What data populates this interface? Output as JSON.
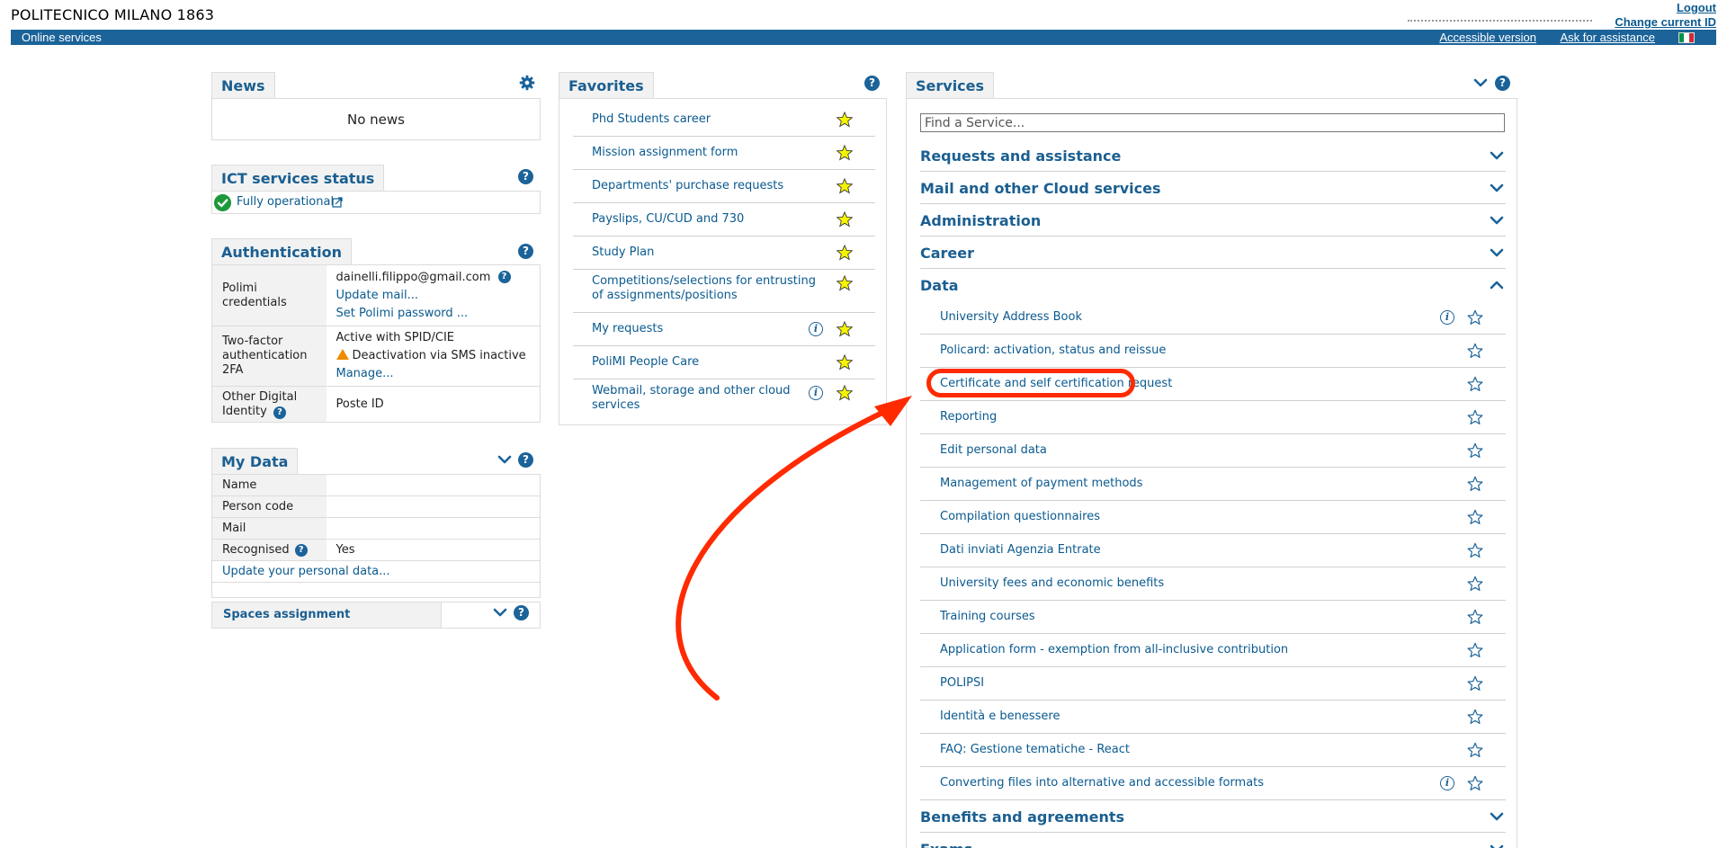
{
  "header": {
    "logo": "POLITECNICO MILANO 1863",
    "logout": "Logout",
    "change_id": "Change current ID",
    "online_services": "Online services",
    "accessible_version": "Accessible version",
    "ask_assistance": "Ask for assistance",
    "flag_colors": [
      "#009246",
      "#ffffff",
      "#ce2b37"
    ]
  },
  "news": {
    "title": "News",
    "empty": "No news"
  },
  "ict": {
    "title": "ICT services status",
    "status": "Fully operational",
    "status_color": "#1c9a3b"
  },
  "auth": {
    "title": "Authentication",
    "rows": [
      {
        "key": "Polimi credentials",
        "lines": [
          "dainelli.filippo@gmail.com",
          "Update mail...",
          "Set Polimi password ..."
        ]
      },
      {
        "key": "Two-factor authentication 2FA",
        "lines": [
          "Active with SPID/CIE",
          "Deactivation via SMS inactive",
          "Manage..."
        ]
      },
      {
        "key": "Other Digital Identity",
        "lines": [
          "Poste ID"
        ]
      }
    ]
  },
  "mydata": {
    "title": "My Data",
    "rows": [
      {
        "key": "Name",
        "value": ""
      },
      {
        "key": "Person code",
        "value": ""
      },
      {
        "key": "Mail",
        "value": ""
      },
      {
        "key": "Recognised",
        "value": "Yes"
      }
    ],
    "update_link": "Update your personal data...",
    "spaces": "Spaces assignment"
  },
  "favorites": {
    "title": "Favorites",
    "items": [
      {
        "label": "Phd Students career"
      },
      {
        "label": "Mission assignment form"
      },
      {
        "label": "Departments' purchase requests"
      },
      {
        "label": "Payslips, CU/CUD and 730"
      },
      {
        "label": "Study Plan"
      },
      {
        "label": "Competitions/selections for entrusting of assignments/positions"
      },
      {
        "label": "My requests"
      },
      {
        "label": "PoliMI People Care"
      },
      {
        "label": "Webmail, storage and other cloud services"
      }
    ]
  },
  "services": {
    "title": "Services",
    "search_placeholder": "Find a Service...",
    "categories_top": [
      "Requests and assistance",
      "Mail and other Cloud services",
      "Administration",
      "Career",
      "Data"
    ],
    "data_items": [
      {
        "label": "University Address Book"
      },
      {
        "label": "Policard: activation, status and reissue"
      },
      {
        "label": "Certificate and self certification request"
      },
      {
        "label": "Reporting"
      },
      {
        "label": "Edit personal data"
      },
      {
        "label": "Management of payment methods"
      },
      {
        "label": "Compilation questionnaires"
      },
      {
        "label": "Dati inviati Agenzia Entrate"
      },
      {
        "label": "University fees and economic benefits"
      },
      {
        "label": "Training courses"
      },
      {
        "label": "Application form - exemption from all-inclusive contribution"
      },
      {
        "label": "POLIPSI"
      },
      {
        "label": "Identità e benessere"
      },
      {
        "label": "FAQ: Gestione tematiche - React"
      },
      {
        "label": "Converting files into alternative and accessible formats"
      }
    ],
    "categories_bottom": [
      "Benefits and agreements",
      "Exams"
    ]
  },
  "colors": {
    "brand_blue": "#1b6399",
    "link": "#0a5a8f",
    "star": "#f5f500",
    "annotation": "#ff2a00"
  }
}
